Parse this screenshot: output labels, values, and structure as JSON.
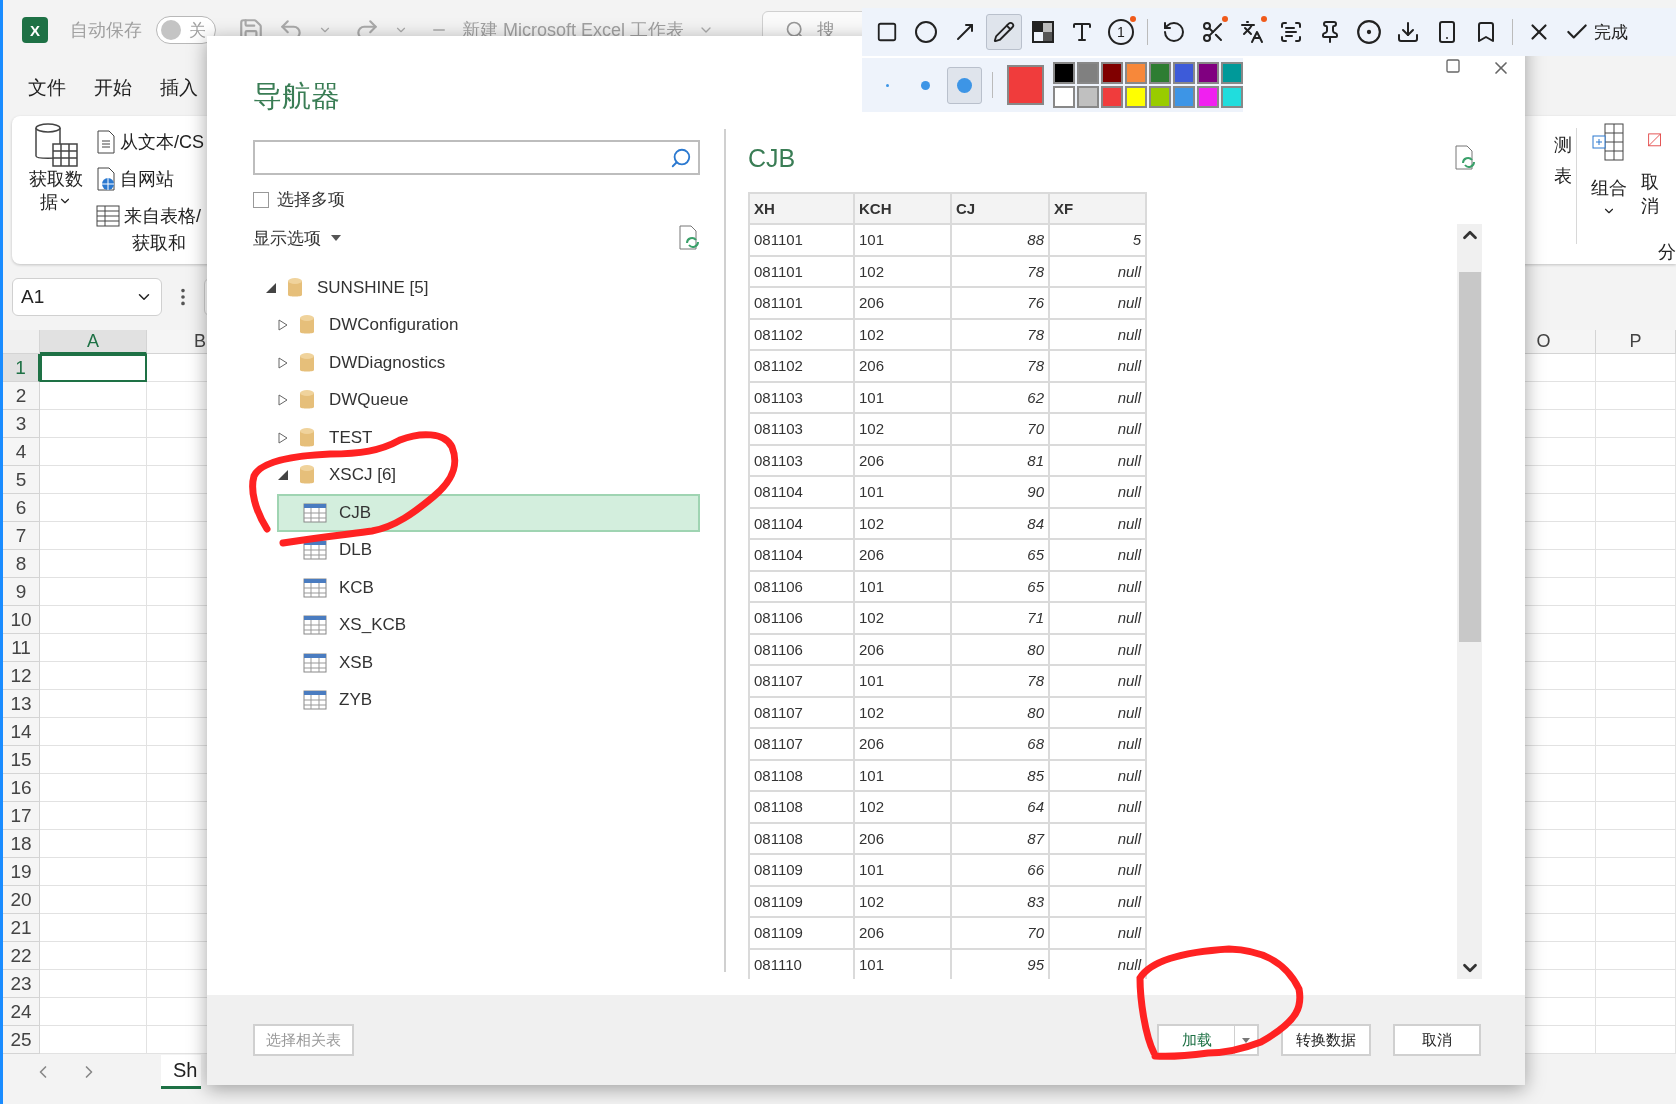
{
  "excel": {
    "title_bar": {
      "logo": "X",
      "autosave_label": "自动保存",
      "autosave": {
        "on": false,
        "label": "关"
      },
      "document_title": "新建 Microsoft Excel 工作表",
      "search_placeholder": "搜"
    },
    "menu_tabs": [
      {
        "label": "文件"
      },
      {
        "label": "开始"
      },
      {
        "label": "插入"
      }
    ],
    "ribbon": {
      "get_data": "获取数据",
      "sources": [
        {
          "kind": "text",
          "label": "从文本/CS"
        },
        {
          "kind": "web",
          "label": "自网站"
        },
        {
          "kind": "table",
          "label": "来自表格/"
        }
      ],
      "group_label": "获取和",
      "partial_button_lines": [
        "测",
        "表"
      ],
      "group_button": "组合",
      "ungroup_button": "取消",
      "right_group_label": "分"
    },
    "name_box": "A1",
    "columns": [
      {
        "label": "A",
        "selected": true
      },
      {
        "label": "B",
        "selected": false
      },
      {
        "label": "O",
        "selected": false
      },
      {
        "label": "P",
        "selected": false
      }
    ],
    "rows": [
      {
        "label": "1",
        "selected": true
      },
      {
        "label": "2",
        "selected": false
      },
      {
        "label": "3",
        "selected": false
      },
      {
        "label": "4",
        "selected": false
      },
      {
        "label": "5",
        "selected": false
      },
      {
        "label": "6",
        "selected": false
      },
      {
        "label": "7",
        "selected": false
      },
      {
        "label": "8",
        "selected": false
      },
      {
        "label": "9",
        "selected": false
      },
      {
        "label": "10",
        "selected": false
      },
      {
        "label": "11",
        "selected": false
      },
      {
        "label": "12",
        "selected": false
      },
      {
        "label": "13",
        "selected": false
      },
      {
        "label": "14",
        "selected": false
      },
      {
        "label": "15",
        "selected": false
      },
      {
        "label": "16",
        "selected": false
      },
      {
        "label": "17",
        "selected": false
      },
      {
        "label": "18",
        "selected": false
      },
      {
        "label": "19",
        "selected": false
      },
      {
        "label": "20",
        "selected": false
      },
      {
        "label": "21",
        "selected": false
      },
      {
        "label": "22",
        "selected": false
      },
      {
        "label": "23",
        "selected": false
      },
      {
        "label": "24",
        "selected": false
      },
      {
        "label": "25",
        "selected": false
      }
    ],
    "sheet_tabs": [
      {
        "label": "Sh",
        "selected": true
      }
    ]
  },
  "navigator": {
    "title": "导航器",
    "multi_select": {
      "label": "选择多项",
      "checked": false
    },
    "display_options": "显示选项",
    "tree": [
      {
        "kind": "database",
        "label": "SUNSHINE [5]",
        "expanded": true,
        "children": [
          {
            "kind": "database",
            "label": "DWConfiguration",
            "expanded": false
          },
          {
            "kind": "database",
            "label": "DWDiagnostics",
            "expanded": false
          },
          {
            "kind": "database",
            "label": "DWQueue",
            "expanded": false
          },
          {
            "kind": "database",
            "label": "TEST",
            "expanded": false
          },
          {
            "kind": "database",
            "label": "XSCJ [6]",
            "expanded": true,
            "children": [
              {
                "kind": "table",
                "label": "CJB",
                "selected": true
              },
              {
                "kind": "table",
                "label": "DLB",
                "selected": false
              },
              {
                "kind": "table",
                "label": "KCB",
                "selected": false
              },
              {
                "kind": "table",
                "label": "XS_KCB",
                "selected": false
              },
              {
                "kind": "table",
                "label": "XSB",
                "selected": false
              },
              {
                "kind": "table",
                "label": "ZYB",
                "selected": false
              }
            ]
          }
        ]
      }
    ],
    "preview": {
      "title": "CJB",
      "columns": [
        {
          "label": "XH",
          "kind": "text"
        },
        {
          "label": "KCH",
          "kind": "text"
        },
        {
          "label": "CJ",
          "kind": "number"
        },
        {
          "label": "XF",
          "kind": "number"
        }
      ],
      "rows": [
        [
          "081101",
          "101",
          "88",
          "5"
        ],
        [
          "081101",
          "102",
          "78",
          "null"
        ],
        [
          "081101",
          "206",
          "76",
          "null"
        ],
        [
          "081102",
          "102",
          "78",
          "null"
        ],
        [
          "081102",
          "206",
          "78",
          "null"
        ],
        [
          "081103",
          "101",
          "62",
          "null"
        ],
        [
          "081103",
          "102",
          "70",
          "null"
        ],
        [
          "081103",
          "206",
          "81",
          "null"
        ],
        [
          "081104",
          "101",
          "90",
          "null"
        ],
        [
          "081104",
          "102",
          "84",
          "null"
        ],
        [
          "081104",
          "206",
          "65",
          "null"
        ],
        [
          "081106",
          "101",
          "65",
          "null"
        ],
        [
          "081106",
          "102",
          "71",
          "null"
        ],
        [
          "081106",
          "206",
          "80",
          "null"
        ],
        [
          "081107",
          "101",
          "78",
          "null"
        ],
        [
          "081107",
          "102",
          "80",
          "null"
        ],
        [
          "081107",
          "206",
          "68",
          "null"
        ],
        [
          "081108",
          "101",
          "85",
          "null"
        ],
        [
          "081108",
          "102",
          "64",
          "null"
        ],
        [
          "081108",
          "206",
          "87",
          "null"
        ],
        [
          "081109",
          "101",
          "66",
          "null"
        ],
        [
          "081109",
          "102",
          "83",
          "null"
        ],
        [
          "081109",
          "206",
          "70",
          "null"
        ],
        [
          "081110",
          "101",
          "95",
          "null"
        ]
      ]
    },
    "footer": {
      "select_related": {
        "label": "选择相关表",
        "disabled": true
      },
      "load": "加载",
      "transform": "转换数据",
      "cancel": "取消"
    }
  },
  "capture_toolbar": {
    "tool_groups": [
      {
        "tools": [
          {
            "kind": "rect",
            "selected": false,
            "badge": false
          },
          {
            "kind": "ellipse",
            "selected": false,
            "badge": false
          },
          {
            "kind": "arrow",
            "selected": false,
            "badge": false
          },
          {
            "kind": "pencil",
            "selected": true,
            "badge": false
          },
          {
            "kind": "mosaic",
            "selected": false,
            "badge": false
          },
          {
            "kind": "text",
            "selected": false,
            "badge": false
          },
          {
            "kind": "number",
            "label": "1",
            "selected": false,
            "badge": true
          }
        ]
      },
      {
        "tools": [
          {
            "kind": "undo",
            "selected": false,
            "badge": false
          },
          {
            "kind": "cut",
            "selected": false,
            "badge": true
          },
          {
            "kind": "translate",
            "selected": false,
            "badge": true
          },
          {
            "kind": "ocr",
            "selected": false,
            "badge": false
          },
          {
            "kind": "pin",
            "selected": false,
            "badge": false
          },
          {
            "kind": "record",
            "selected": false,
            "badge": false
          },
          {
            "kind": "download",
            "selected": false,
            "badge": false
          },
          {
            "kind": "device",
            "selected": false,
            "badge": false
          },
          {
            "kind": "bookmark",
            "selected": false,
            "badge": false
          }
        ]
      },
      {
        "tools": [
          {
            "kind": "close",
            "selected": false,
            "badge": false
          },
          {
            "kind": "done",
            "label": "完成",
            "selected": false,
            "badge": false
          }
        ]
      }
    ],
    "brush_sizes": [
      {
        "selected": false
      },
      {
        "selected": false
      },
      {
        "selected": true
      }
    ],
    "current_color": {
      "color": "#f03c3c"
    },
    "palette": [
      {
        "color": "#000000"
      },
      {
        "color": "#808080"
      },
      {
        "color": "#800000"
      },
      {
        "color": "#f7883a"
      },
      {
        "color": "#2e7d32"
      },
      {
        "color": "#3d5bd9"
      },
      {
        "color": "#800080"
      },
      {
        "color": "#009999"
      },
      {
        "color": "#ffffff"
      },
      {
        "color": "#c0c0c0"
      },
      {
        "color": "#f03c3c"
      },
      {
        "color": "#ffff00"
      },
      {
        "color": "#99cc00"
      },
      {
        "color": "#3d95e6"
      },
      {
        "color": "#f020f0"
      },
      {
        "color": "#20dddd"
      }
    ]
  }
}
